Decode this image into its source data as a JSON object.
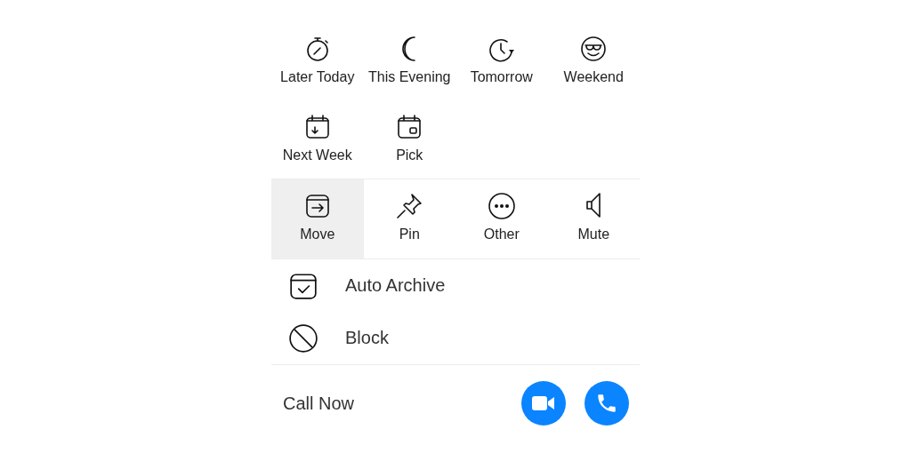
{
  "snooze_options": [
    {
      "label": "Later Today"
    },
    {
      "label": "This Evening"
    },
    {
      "label": "Tomorrow"
    },
    {
      "label": "Weekend"
    },
    {
      "label": "Next Week"
    },
    {
      "label": "Pick"
    }
  ],
  "actions": [
    {
      "label": "Move",
      "selected": true
    },
    {
      "label": "Pin",
      "selected": false
    },
    {
      "label": "Other",
      "selected": false
    },
    {
      "label": "Mute",
      "selected": false
    }
  ],
  "list_items": [
    {
      "label": "Auto Archive"
    },
    {
      "label": "Block"
    }
  ],
  "call": {
    "label": "Call Now"
  }
}
